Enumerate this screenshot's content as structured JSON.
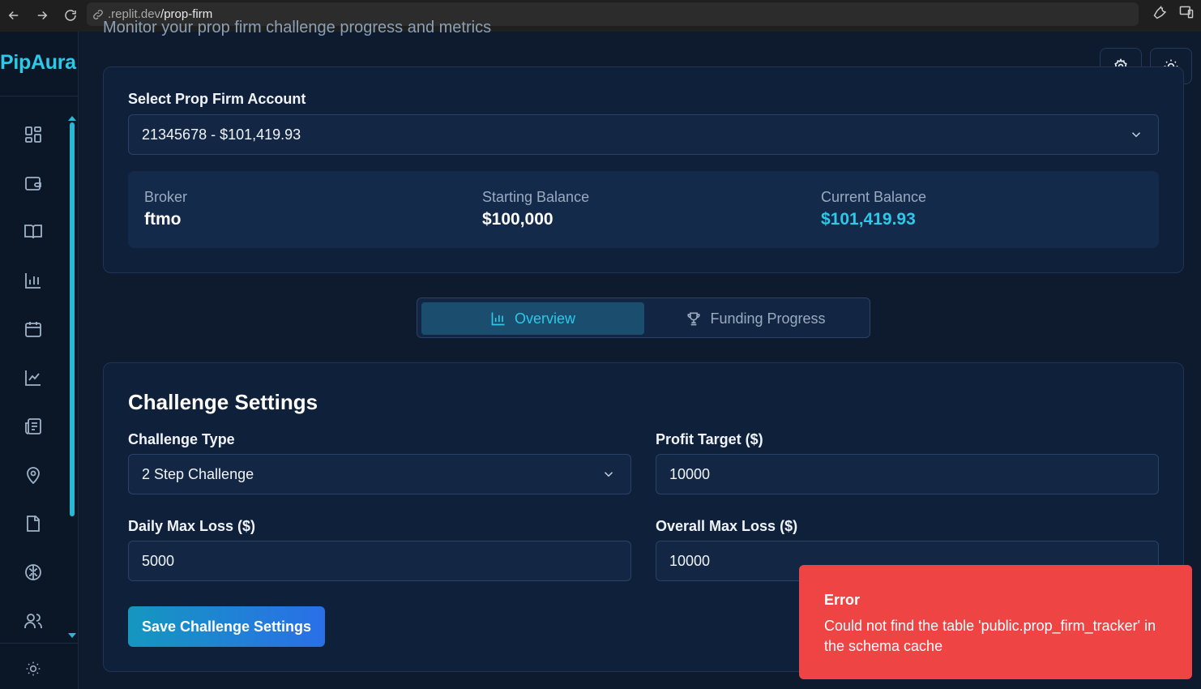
{
  "browser": {
    "url_host": ".replit.dev",
    "url_path": "/prop-firm"
  },
  "sidebar": {
    "brand": "PipAura",
    "icons": [
      "dashboard-icon",
      "wallet-icon",
      "journal-icon",
      "bar-chart-icon",
      "calendar-icon",
      "line-chart-icon",
      "news-icon",
      "location-icon",
      "file-icon",
      "brain-icon",
      "users-icon",
      "sun-icon"
    ]
  },
  "header": {
    "subtitle": "Monitor your prop firm challenge progress and metrics"
  },
  "account": {
    "select_label": "Select Prop Firm Account",
    "selected": "21345678 - $101,419.93",
    "broker_label": "Broker",
    "broker_value": "ftmo",
    "starting_label": "Starting Balance",
    "starting_value": "$100,000",
    "current_label": "Current Balance",
    "current_value": "$101,419.93"
  },
  "tabs": [
    {
      "label": "Overview",
      "active": true
    },
    {
      "label": "Funding Progress",
      "active": false
    }
  ],
  "challenge": {
    "title": "Challenge Settings",
    "type_label": "Challenge Type",
    "type_value": "2 Step Challenge",
    "profit_label": "Profit Target ($)",
    "profit_value": "10000",
    "daily_label": "Daily Max Loss ($)",
    "daily_value": "5000",
    "overall_label": "Overall Max Loss ($)",
    "overall_value": "10000",
    "save_label": "Save Challenge Settings"
  },
  "toast": {
    "title": "Error",
    "message": "Could not find the table 'public.prop_firm_tracker' in the schema cache"
  },
  "colors": {
    "accent": "#2ec8e8",
    "error": "#ef4444",
    "background": "#0e1a2e"
  }
}
